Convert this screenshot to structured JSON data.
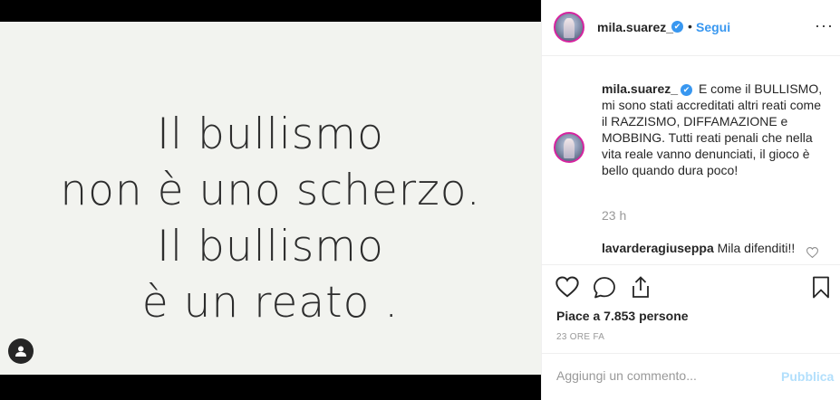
{
  "post": {
    "quote_lines": [
      "Il bullismo",
      "non è uno scherzo.",
      "Il bullismo",
      "è un reato ."
    ]
  },
  "header": {
    "username": "mila.suarez_",
    "separator": "•",
    "follow_label": "Segui",
    "more_label": "···"
  },
  "caption": {
    "username": "mila.suarez_",
    "text": "E come il BULLISMO, mi sono stati accreditati altri reati come il RAZZISMO, DIFFAMAZIONE e MOBBING. Tutti reati penali che nella vita reale vanno denunciati, il gioco è bello quando dura poco!",
    "time": "23 h"
  },
  "comments": [
    {
      "username": "lavarderagiuseppa",
      "text": "Mila difenditi!!"
    }
  ],
  "actions": {
    "likes_text": "Piace a 7.853 persone",
    "time_ago": "23 ORE FA"
  },
  "add_comment": {
    "placeholder": "Aggiungi un commento...",
    "publish_label": "Pubblica"
  },
  "colors": {
    "accent": "#3897f0",
    "publish_disabled": "#b2dffc",
    "muted": "#999999"
  },
  "icons": [
    "user-tag-icon",
    "verified-badge-icon",
    "more-options-icon",
    "heart-icon",
    "comment-icon",
    "share-icon",
    "bookmark-icon"
  ]
}
